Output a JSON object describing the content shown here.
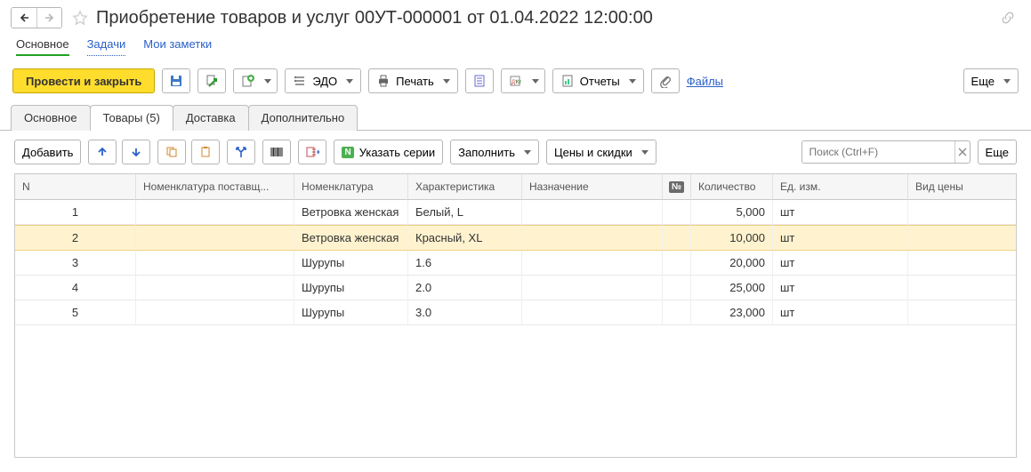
{
  "header": {
    "title": "Приобретение товаров и услуг 00УТ-000001 от 01.04.2022 12:00:00"
  },
  "subnav": {
    "main": "Основное",
    "tasks": "Задачи",
    "notes": "Мои заметки"
  },
  "toolbar": {
    "submit_close": "Провести и закрыть",
    "edo": "ЭДО",
    "print": "Печать",
    "reports": "Отчеты",
    "files": "Файлы",
    "more": "Еще"
  },
  "tabs": {
    "osnovnoe": "Основное",
    "tovary": "Товары (5)",
    "dostavka": "Доставка",
    "dop": "Дополнительно"
  },
  "subtoolbar": {
    "add": "Добавить",
    "series": "Указать серии",
    "fill": "Заполнить",
    "prices": "Цены и скидки",
    "search_placeholder": "Поиск (Ctrl+F)",
    "more": "Еще"
  },
  "table": {
    "headers": {
      "n": "N",
      "nom_supplier": "Номенклатура поставщ...",
      "nom": "Номенклатура",
      "char": "Характеристика",
      "assign": "Назначение",
      "no_badge": "№",
      "qty": "Количество",
      "unit": "Ед. изм.",
      "price_type": "Вид цены"
    },
    "rows": [
      {
        "n": "1",
        "nom_supplier": "",
        "nom": "Ветровка женская",
        "char": "Белый, L",
        "assign": "",
        "no": "",
        "qty": "5,000",
        "unit": "шт",
        "price_type": ""
      },
      {
        "n": "2",
        "nom_supplier": "",
        "nom": "Ветровка женская",
        "char": "Красный, XL",
        "assign": "",
        "no": "",
        "qty": "10,000",
        "unit": "шт",
        "price_type": ""
      },
      {
        "n": "3",
        "nom_supplier": "",
        "nom": "Шурупы",
        "char": "1.6",
        "assign": "",
        "no": "",
        "qty": "20,000",
        "unit": "шт",
        "price_type": ""
      },
      {
        "n": "4",
        "nom_supplier": "",
        "nom": "Шурупы",
        "char": "2.0",
        "assign": "",
        "no": "",
        "qty": "25,000",
        "unit": "шт",
        "price_type": ""
      },
      {
        "n": "5",
        "nom_supplier": "",
        "nom": "Шурупы",
        "char": "3.0",
        "assign": "",
        "no": "",
        "qty": "23,000",
        "unit": "шт",
        "price_type": ""
      }
    ],
    "selected_index": 1
  }
}
